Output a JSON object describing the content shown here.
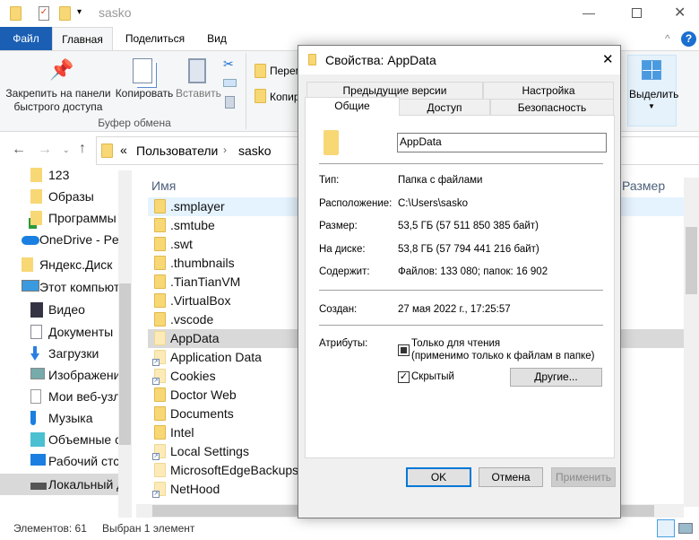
{
  "window": {
    "title": "sasko"
  },
  "ribbon": {
    "tabs": [
      "Файл",
      "Главная",
      "Поделиться",
      "Вид"
    ],
    "pin_label_1": "Закрепить на панели",
    "pin_label_2": "быстрого доступа",
    "copy": "Копировать",
    "paste": "Вставить",
    "group_clipboard": "Буфер обмена",
    "move": "Перем",
    "copyto": "Копир",
    "select": "Выделить"
  },
  "address": {
    "prefix": "«",
    "parts": [
      "Пользователи",
      "sasko"
    ]
  },
  "nav": [
    {
      "label": "123",
      "icon": "folder-icon"
    },
    {
      "label": "Образы",
      "icon": "folder-icon"
    },
    {
      "label": "Программы",
      "icon": "folder-sync-icon"
    },
    {
      "label": "OneDrive - Pe",
      "icon": "onedrive-icon"
    },
    {
      "label": "Яндекс.Диск",
      "icon": "yandex-disk-icon"
    },
    {
      "label": "Этот компьют",
      "icon": "computer-icon"
    },
    {
      "label": "Видео",
      "icon": "video-icon"
    },
    {
      "label": "Документы",
      "icon": "documents-icon"
    },
    {
      "label": "Загрузки",
      "icon": "downloads-icon"
    },
    {
      "label": "Изображени",
      "icon": "pictures-icon"
    },
    {
      "label": "Мои веб-узл",
      "icon": "file-icon"
    },
    {
      "label": "Музыка",
      "icon": "music-icon"
    },
    {
      "label": "Объемные с",
      "icon": "3d-objects-icon"
    },
    {
      "label": "Рабочий стс",
      "icon": "desktop-icon"
    },
    {
      "label": "Локальный д",
      "icon": "local-disk-icon"
    }
  ],
  "list": {
    "col_name": "Имя",
    "col_size": "Размер",
    "items": [
      {
        "name": ".smplayer",
        "type": "folder"
      },
      {
        "name": ".smtube",
        "type": "folder"
      },
      {
        "name": ".swt",
        "type": "folder"
      },
      {
        "name": ".thumbnails",
        "type": "folder"
      },
      {
        "name": ".TianTianVM",
        "type": "folder"
      },
      {
        "name": ".VirtualBox",
        "type": "folder"
      },
      {
        "name": ".vscode",
        "type": "folder"
      },
      {
        "name": "AppData",
        "type": "folder-hidden",
        "selected": true
      },
      {
        "name": "Application Data",
        "type": "link"
      },
      {
        "name": "Cookies",
        "type": "link"
      },
      {
        "name": "Doctor Web",
        "type": "folder"
      },
      {
        "name": "Documents",
        "type": "folder"
      },
      {
        "name": "Intel",
        "type": "folder"
      },
      {
        "name": "Local Settings",
        "type": "link"
      },
      {
        "name": "MicrosoftEdgeBackups",
        "type": "folder-hidden"
      },
      {
        "name": "NetHood",
        "type": "link"
      }
    ]
  },
  "status": {
    "count": "Элементов: 61",
    "selected": "Выбран 1 элемент"
  },
  "dialog": {
    "title": "Свойства: AppData",
    "tabs_row1": [
      "Предыдущие версии",
      "Настройка"
    ],
    "tabs_row2": [
      "Общие",
      "Доступ",
      "Безопасность"
    ],
    "name": "AppData",
    "fields": [
      {
        "label": "Тип:",
        "value": "Папка с файлами"
      },
      {
        "label": "Расположение:",
        "value": "C:\\Users\\sasko"
      },
      {
        "label": "Размер:",
        "value": "53,5 ГБ (57 511 850 385 байт)"
      },
      {
        "label": "На диске:",
        "value": "53,8 ГБ (57 794 441 216 байт)"
      },
      {
        "label": "Содержит:",
        "value": "Файлов: 133 080; папок: 16 902"
      }
    ],
    "created_label": "Создан:",
    "created_value": "27 мая 2022 г., 17:25:57",
    "attr_label": "Атрибуты:",
    "readonly_1": "Только для чтения",
    "readonly_2": "(применимо только к файлам в папке)",
    "readonly_state": "indeterminate",
    "hidden": "Скрытый",
    "hidden_checked": true,
    "other": "Другие...",
    "ok": "OK",
    "cancel": "Отмена",
    "apply": "Применить"
  },
  "colors": {
    "accent": "#1a5fb4",
    "selected_row": "#d9d9d9",
    "hover_row": "#e5f3ff"
  }
}
